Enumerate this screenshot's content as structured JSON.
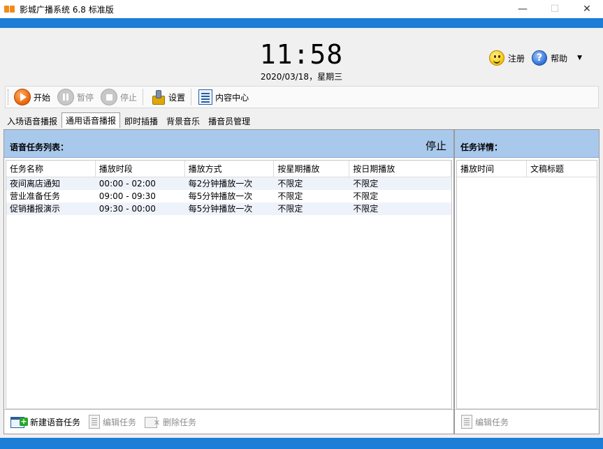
{
  "window": {
    "title": "影城广播系统 6.8 标准版",
    "minimize_glyph": "—",
    "maximize_glyph": "☐",
    "close_glyph": "✕",
    "accent_color": "#1c7ed6"
  },
  "header": {
    "clock": "11:58",
    "date": "2020/03/18，星期三",
    "register_label": "注册",
    "help_label": "帮助",
    "dropdown_glyph": "▼"
  },
  "toolbar": {
    "start_label": "开始",
    "pause_label": "暂停",
    "stop_label": "停止",
    "settings_label": "设置",
    "content_center_label": "内容中心"
  },
  "tabs": [
    {
      "label": "入场语音播报"
    },
    {
      "label": "通用语音播报"
    },
    {
      "label": "即时插播"
    },
    {
      "label": "背景音乐"
    },
    {
      "label": "播音员管理"
    }
  ],
  "task_list": {
    "title": "语音任务列表：",
    "status": "停止",
    "columns": [
      "任务名称",
      "播放时段",
      "播放方式",
      "按星期播放",
      "按日期播放"
    ],
    "rows": [
      [
        "夜间离店通知",
        "00:00 - 02:00",
        "每2分钟播放一次",
        "不限定",
        "不限定"
      ],
      [
        "营业准备任务",
        "09:00 - 09:30",
        "每5分钟播放一次",
        "不限定",
        "不限定"
      ],
      [
        "促销播报演示",
        "09:30 - 00:00",
        "每5分钟播放一次",
        "不限定",
        "不限定"
      ]
    ],
    "new_task_label": "新建语音任务",
    "edit_task_label": "编辑任务",
    "delete_task_label": "删除任务"
  },
  "task_detail": {
    "title": "任务详情：",
    "columns": [
      "播放时间",
      "文稿标题"
    ],
    "edit_task_label": "编辑任务"
  }
}
